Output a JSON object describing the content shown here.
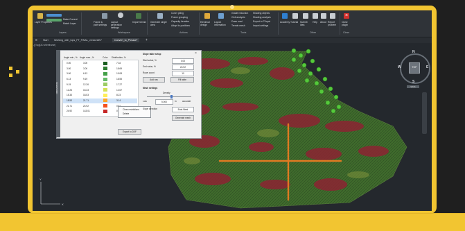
{
  "ribbon": {
    "left_items": [
      "Layer Properties",
      "Make Current",
      "Match Layer"
    ],
    "layers_group": "Layers",
    "workspace_items": [
      "Frame & path settings",
      "Layout generation settings",
      "Import terrain"
    ],
    "workspace_group": "Workspace",
    "generate_items": [
      "Generate single area"
    ],
    "actions_list": [
      "Cover piling",
      "Frame grouping",
      "Capacity iteration",
      "Adapt to positions"
    ],
    "actions_group": "Actions",
    "tools_a": [
      "Electrical design",
      "Layout information"
    ],
    "tools_list": [
      "Grade reduction",
      "Civil analysis",
      "Draw road",
      "Terrain mesh"
    ],
    "tools_b": [
      "Shading objects",
      "Shading analysis",
      "Export to PVsyst",
      "Import settings"
    ],
    "tools_group": "Tools",
    "other_items": [
      "Academy",
      "Tutorial",
      "Submit idea",
      "Help",
      "About",
      "Report problem"
    ],
    "other_group": "Other",
    "close_item": "Close plugin",
    "close_group": "Close"
  },
  "tabs": {
    "start": "Start",
    "file": "Working_with_tops_FT_FINAL_version6K7",
    "active": "Convert_to_PVcase*"
  },
  "breadcrumb": "-][Top][2D Wireframe]",
  "dialog": {
    "side_label": "ORIENTATION",
    "close_symbol": "×",
    "table": {
      "headers": [
        "Angle min., %",
        "Angle max., %",
        "Color",
        "Distribution, %"
      ],
      "rows": [
        {
          "min": "0.00",
          "max": "3.00",
          "color": "#1b5e20",
          "dist": "7.34"
        },
        {
          "min": "3.00",
          "max": "3.00",
          "color": "#2e7d32",
          "dist": "18.69"
        },
        {
          "min": "3.00",
          "max": "6.13",
          "color": "#43a047",
          "dist": "19.08"
        },
        {
          "min": "6.13",
          "max": "9.19",
          "color": "#66bb6a",
          "dist": "18.55"
        },
        {
          "min": "9.19",
          "max": "12.26",
          "color": "#9ccc65",
          "dist": "17.27"
        },
        {
          "min": "12.26",
          "max": "15.33",
          "color": "#d4e157",
          "dist": "12.67"
        },
        {
          "min": "15.33",
          "max": "18.53",
          "color": "#ffee58",
          "dist": "8.23"
        },
        {
          "min": "18.53",
          "max": "21.71",
          "color": "#ffa726",
          "dist": "3.14"
        },
        {
          "min": "21.71",
          "max": "24.92",
          "color": "#f4511e",
          "dist": "0.81"
        },
        {
          "min": "24.92",
          "max": "143.01",
          "color": "#c62828",
          "dist": "0.22"
        }
      ]
    },
    "context_menu": [
      "Clear restrictions",
      "Delete"
    ],
    "slope_setup": {
      "title": "Slope table setup",
      "start_label": "Start value, %",
      "start_value": "0.00",
      "end_label": "End value, %",
      "end_value": "24.92",
      "rows_label": "Rows count",
      "rows_value": "10",
      "add_button": "Add row",
      "fill_button": "Fill table"
    },
    "mesh": {
      "title": "Mesh settings",
      "density_label": "Density",
      "density": 0.55,
      "low_label": "Low",
      "value": "5.000",
      "unit": "m",
      "high_label": "accurate",
      "dir_label": "Slope direction",
      "dir_value": "East-West",
      "generate_button": "Generate mesh"
    },
    "export_button": "Export to DXF"
  },
  "compass": {
    "n": "N",
    "s": "S",
    "e": "E",
    "w": "W",
    "cube": "TOP",
    "tag": "WCS"
  },
  "colors": {
    "frame": "#f2c531",
    "terrain_low": "#3f6b2c",
    "terrain_high": "#8c2432",
    "road": "#e07a22",
    "marker": "#55c93b"
  }
}
